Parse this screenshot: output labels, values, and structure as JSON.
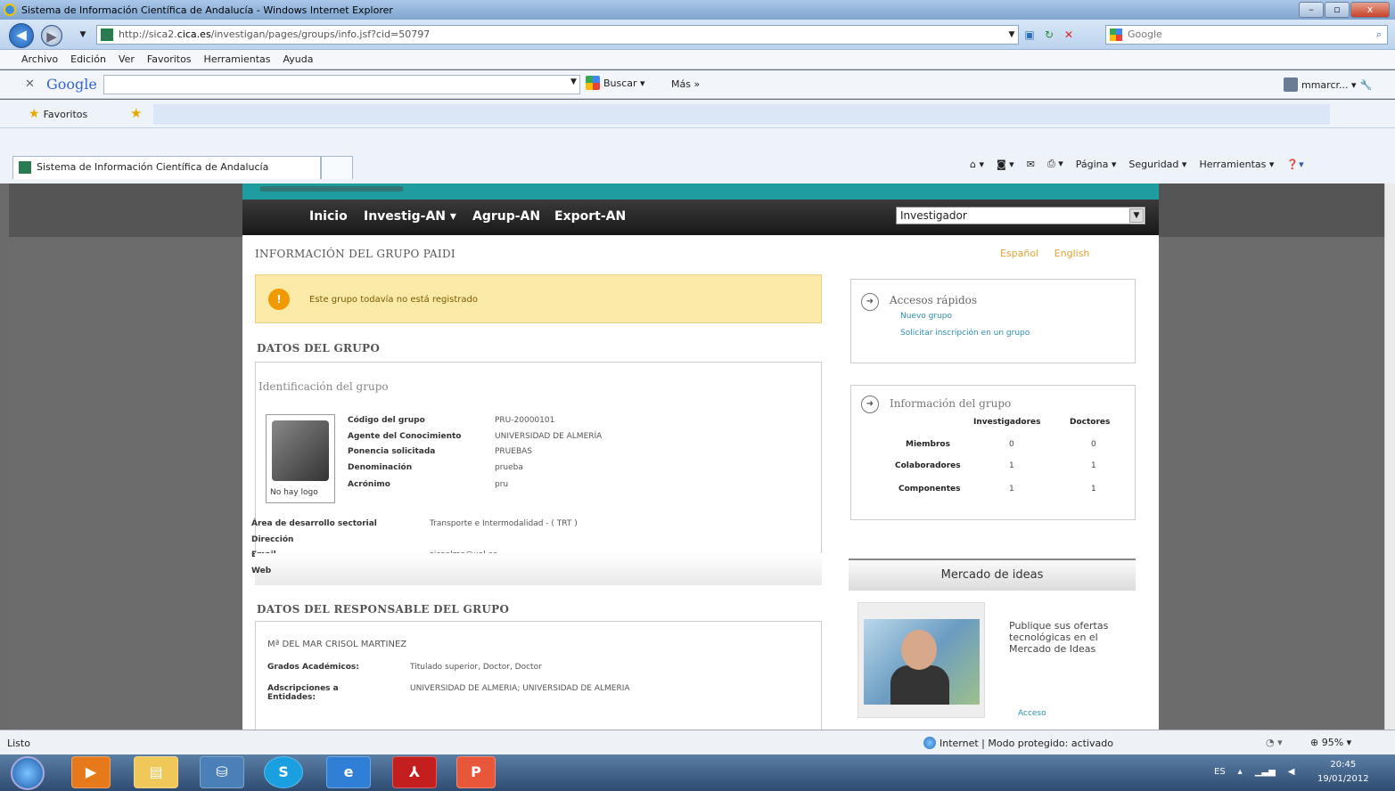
{
  "window": {
    "title": "Sistema de Información Científica de Andalucía - Windows Internet Explorer"
  },
  "addressbar": {
    "url_prefix": "http://sica2.",
    "url_domain": "cica.es",
    "url_path": "/investigan/pages/groups/info.jsf?cid=50797",
    "search_placeholder": "Google"
  },
  "menu": [
    "Archivo",
    "Edición",
    "Ver",
    "Favoritos",
    "Herramientas",
    "Ayuda"
  ],
  "google_toolbar": {
    "logo": "Google",
    "buscar": "Buscar ▾",
    "mas": "Más »",
    "user": "mmarcr... ▾"
  },
  "favorites": {
    "label": "Favoritos"
  },
  "tabs": [
    {
      "label": "Sistema de Información Científica de Andalucía"
    }
  ],
  "commandbar": {
    "pagina": "Página ▾",
    "seguridad": "Seguridad ▾",
    "herramientas": "Herramientas ▾"
  },
  "site_nav": {
    "items": [
      "Inicio",
      "Investig-AN ▾",
      "Agrup-AN",
      "Export-AN"
    ],
    "select_value": "Investigador"
  },
  "page": {
    "title": "INFORMACIÓN DEL GRUPO PAIDI",
    "lang_es": "Español",
    "lang_en": "English",
    "warning": "Este grupo todavía no está registrado",
    "datos_grupo": "DATOS DEL GRUPO",
    "identificacion": "Identificación del grupo",
    "no_logo": "No hay logo",
    "fields": [
      {
        "label": "Código del grupo",
        "value": "PRU-20000101"
      },
      {
        "label": "Agente del Conocimiento",
        "value": "UNIVERSIDAD DE ALMERÍA"
      },
      {
        "label": "Ponencia solicitada",
        "value": "PRUEBAS"
      },
      {
        "label": "Denominación",
        "value": "prueba"
      },
      {
        "label": "Acrónimo",
        "value": "pru"
      }
    ],
    "area_label": "Área de desarrollo sectorial",
    "area_value": "Transporte e Intermodalidad - ( TRT )",
    "direccion_label": "Dirección",
    "email_label": "Email",
    "email_value": "sicaalme@ual.es",
    "web_label": "Web",
    "responsable_header": "DATOS DEL RESPONSABLE DEL GRUPO",
    "responsable_name": "Mª DEL MAR CRISOL MARTINEZ",
    "grados_label": "Grados Académicos:",
    "grados_value": "Titulado superior, Doctor, Doctor",
    "adscripciones_label": "Adscripciones a Entidades:",
    "adscripciones_value": "UNIVERSIDAD DE ALMERIA; UNIVERSIDAD DE ALMERIA"
  },
  "quick_access": {
    "title": "Accesos rápidos",
    "links": [
      "Nuevo grupo",
      "Solicitar inscripción en un grupo"
    ]
  },
  "group_info": {
    "title": "Información del grupo",
    "columns": [
      "Investigadores",
      "Doctores"
    ],
    "rows": [
      {
        "label": "Miembros",
        "investigadores": "0",
        "doctores": "0"
      },
      {
        "label": "Colaboradores",
        "investigadores": "1",
        "doctores": "1"
      },
      {
        "label": "Componentes",
        "investigadores": "1",
        "doctores": "1"
      }
    ]
  },
  "mercado": {
    "title": "Mercado de ideas",
    "text": "Publique sus ofertas tecnológicas en el Mercado de Ideas",
    "link": "Acceso"
  },
  "statusbar": {
    "left": "Listo",
    "zone": "Internet | Modo protegido: activado",
    "zoom": "⊕ 95% ▾"
  },
  "taskbar": {
    "time": "20:45",
    "date": "19/01/2012",
    "lang": "ES"
  }
}
